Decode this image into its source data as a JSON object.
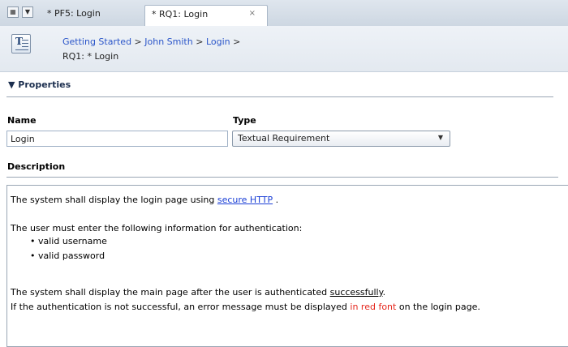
{
  "tabbar": {
    "grid_icon": "grid-icon",
    "dropdown_icon": "chevron-down-icon",
    "tabs": [
      {
        "label": "* PF5: Login"
      },
      {
        "label": "* RQ1: Login",
        "close": "×"
      }
    ]
  },
  "header": {
    "icon": "textual-requirement-icon",
    "breadcrumb": {
      "items": [
        "Getting Started",
        "John Smith",
        "Login"
      ],
      "separator": ">"
    },
    "current": "RQ1: * Login"
  },
  "properties": {
    "toggle": "▼ Properties",
    "name_label": "Name",
    "name_value": "Login",
    "type_label": "Type",
    "type_value": "Textual Requirement",
    "description_label": "Description"
  },
  "description": {
    "line1_prefix": "The system shall display the login page using ",
    "line1_link": "secure HTTP",
    "line1_suffix": " .",
    "line2": "The user must enter the following information for authentication:",
    "bullets": [
      "valid username",
      "valid password"
    ],
    "line3_prefix": "The system shall display the main page after the user is authenticated ",
    "line3_underlined": "successfully",
    "line3_suffix": ".",
    "line4_prefix": "If the authentication is not successful, an error message must be displayed ",
    "line4_red": "in red font",
    "line4_suffix": " on the login page."
  },
  "colors": {
    "link": "#2a55c9",
    "red_text": "#e5261c",
    "tabbar_bg": "#cdd7e2",
    "header_bg": "#e3e9f0"
  }
}
